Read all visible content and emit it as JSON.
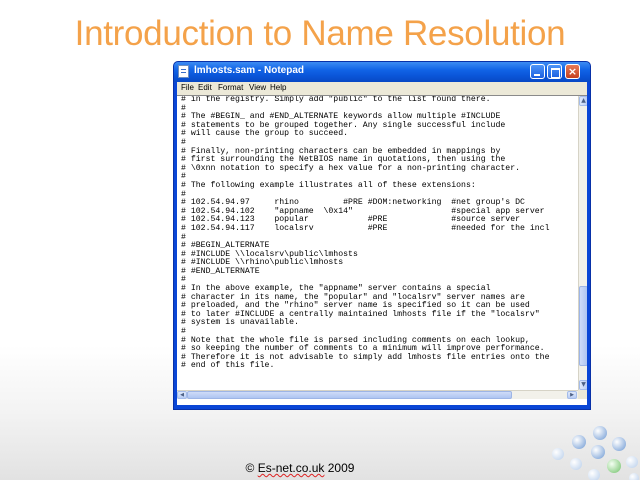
{
  "slide": {
    "title": "Introduction to Name Resolution",
    "footer_prefix": "© ",
    "footer_brand": "Es-net.co.uk",
    "footer_suffix": " 2009"
  },
  "window": {
    "title": "lmhosts.sam - Notepad",
    "menu": [
      "File",
      "Edit",
      "Format",
      "View",
      "Help"
    ],
    "controls": {
      "minimize": "minimize",
      "maximize": "maximize",
      "close": "×"
    }
  },
  "editor": {
    "lines": [
      "# in the registry. Simply add \"public\" to the list found there.",
      "#",
      "# The #BEGIN_ and #END_ALTERNATE keywords allow multiple #INCLUDE",
      "# statements to be grouped together. Any single successful include",
      "# will cause the group to succeed.",
      "#",
      "# Finally, non-printing characters can be embedded in mappings by",
      "# first surrounding the NetBIOS name in quotations, then using the",
      "# \\0xnn notation to specify a hex value for a non-printing character.",
      "#",
      "# The following example illustrates all of these extensions:",
      "#",
      "# 102.54.94.97     rhino         #PRE #DOM:networking  #net group's DC",
      "# 102.54.94.102    \"appname  \\0x14\"                    #special app server",
      "# 102.54.94.123    popular            #PRE             #source server",
      "# 102.54.94.117    localsrv           #PRE             #needed for the incl",
      "#",
      "# #BEGIN_ALTERNATE",
      "# #INCLUDE \\\\localsrv\\public\\lmhosts",
      "# #INCLUDE \\\\rhino\\public\\lmhosts",
      "# #END_ALTERNATE",
      "#",
      "# In the above example, the \"appname\" server contains a special",
      "# character in its name, the \"popular\" and \"localsrv\" server names are",
      "# preloaded, and the \"rhino\" server name is specified so it can be used",
      "# to later #INCLUDE a centrally maintained lmhosts file if the \"localsrv\"",
      "# system is unavailable.",
      "#",
      "# Note that the whole file is parsed including comments on each lookup,",
      "# so keeping the number of comments to a minimum will improve performance.",
      "# Therefore it is not advisable to simply add lmhosts file entries onto the",
      "# end of this file."
    ],
    "scroll_up": "▲",
    "scroll_down": "▼",
    "scroll_left": "◀",
    "scroll_right": "▶"
  },
  "colors": {
    "title_orange": "#f4a24a",
    "xp_blue": "#0a55d8",
    "menu_bg": "#ece9d8",
    "dot_light": "#d6e4f4",
    "dot_mid": "#9fbde6",
    "dot_green": "#9fd39a"
  }
}
